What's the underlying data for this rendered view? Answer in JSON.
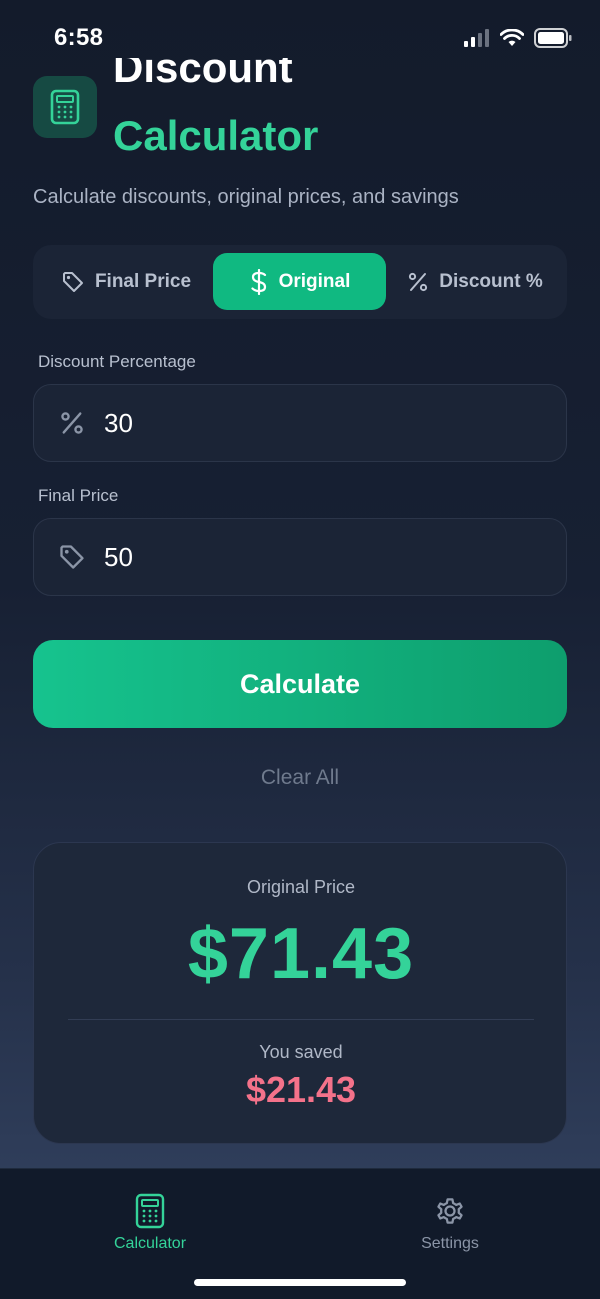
{
  "status_bar": {
    "time": "6:58"
  },
  "header": {
    "title_line1": "Discount",
    "title_line2": "Calculator",
    "subtitle": "Calculate discounts, original prices, and savings"
  },
  "mode_tabs": [
    {
      "label": "Final Price",
      "icon": "tag-icon",
      "active": false
    },
    {
      "label": "Original",
      "icon": "dollar-icon",
      "active": true
    },
    {
      "label": "Discount %",
      "icon": "percent-icon",
      "active": false
    }
  ],
  "fields": {
    "discount": {
      "label": "Discount Percentage",
      "value": "30",
      "icon": "percent-icon"
    },
    "final_price": {
      "label": "Final Price",
      "value": "50",
      "icon": "tag-icon"
    }
  },
  "actions": {
    "calculate_label": "Calculate",
    "clear_label": "Clear All"
  },
  "result": {
    "label": "Original Price",
    "value": "$71.43",
    "saved_label": "You saved",
    "saved_value": "$21.43"
  },
  "tab_bar": [
    {
      "label": "Calculator",
      "icon": "calculator-icon",
      "active": true
    },
    {
      "label": "Settings",
      "icon": "gear-icon",
      "active": false
    }
  ],
  "colors": {
    "accent": "#10b981",
    "accent_text": "#34d399",
    "saved": "#f4728a",
    "background": "#172033"
  }
}
